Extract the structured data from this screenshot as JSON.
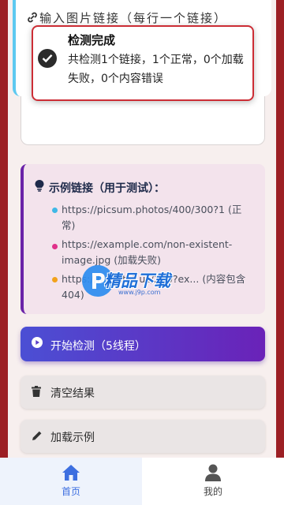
{
  "input_card": {
    "title": "输入图片链接（每行一个链接）"
  },
  "toast": {
    "title": "检测完成",
    "message": "共检测1个链接，1个正常，0个加载失败，0个内容错误"
  },
  "examples": {
    "title": "示例链接（用于测试）：",
    "items": [
      {
        "text": "https://picsum.photos/400/300?1 (正常)",
        "color": "#3fb8e6"
      },
      {
        "text": "https://example.com/non-existent-image.jpg (加载失败)",
        "color": "#e0308a"
      },
      {
        "text": "https://httpstat.us/200?ex... (内容包含404)",
        "color": "#f2a21b"
      }
    ]
  },
  "watermark": {
    "text": "精品下载",
    "url": "www.j9p.com"
  },
  "buttons": {
    "start": "开始检测（5线程）",
    "clear": "清空结果",
    "load_examples": "加载示例"
  },
  "nav": {
    "home": "首页",
    "mine": "我的"
  },
  "colors": {
    "accent_blue": "#3d6fe0",
    "start_gradient_from": "#4b4fd4",
    "start_gradient_to": "#6a22b8",
    "toast_border": "#cc2d35"
  }
}
